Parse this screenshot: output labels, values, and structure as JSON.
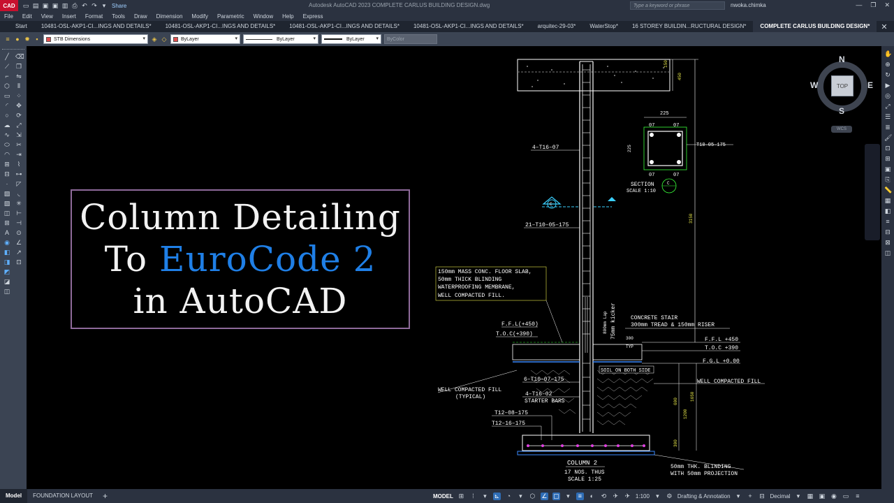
{
  "app": {
    "logo": "CAD",
    "title": "Autodesk AutoCAD 2023    COMPLETE CARLUS BUILDING DESIGN.dwg",
    "share": "Share",
    "search_placeholder": "Type a keyword or phrase",
    "user": "nwoka.chimka"
  },
  "menu": [
    "File",
    "Edit",
    "View",
    "Insert",
    "Format",
    "Tools",
    "Draw",
    "Dimension",
    "Modify",
    "Parametric",
    "Window",
    "Help",
    "Express"
  ],
  "tabs": [
    {
      "label": "Start"
    },
    {
      "label": "10481-OSL-AKP1-CI...INGS AND DETAILS*"
    },
    {
      "label": "10481-OSL-AKP1-CI...INGS AND DETAILS*"
    },
    {
      "label": "10481-OSL-AKP1-CI...INGS AND DETAILS*"
    },
    {
      "label": "10481-OSL-AKP1-CI...INGS AND DETAILS*"
    },
    {
      "label": "arquitec-29-03*"
    },
    {
      "label": "WaterStop*"
    },
    {
      "label": "16 STOREY BUILDIN...RUCTURAL DESIGN*"
    },
    {
      "label": "COMPLETE CARLUS BUILDING DESIGN*"
    }
  ],
  "properties": {
    "layer": "STB Dimensions",
    "color": "ByLayer",
    "linetype": "ByLayer",
    "lineweight": "ByLayer",
    "plotstyle": "ByColor"
  },
  "overlay": {
    "line1": "Column Detailing",
    "line2_prefix": "To ",
    "line2_accent": "EuroCode 2",
    "line3": "in AutoCAD",
    "accent_color": "#1f7fe6",
    "border_color": "#8e6a9a"
  },
  "viewcube": {
    "n": "N",
    "s": "S",
    "e": "E",
    "w": "W",
    "top": "TOP",
    "wcs": "WCS"
  },
  "drawing": {
    "labels": {
      "bars_upper": "4–T16–07",
      "links_upper": "21–T10–05–175",
      "section_label": "SECTION",
      "section_tag": "C",
      "section_scale": "SCALE 1:10",
      "sec_dim": "225",
      "sec_dim_v": "225",
      "sec_bar": "07",
      "sec_links": "T10–05–175",
      "dim_150": "150",
      "dim_450": "450",
      "dim_3150": "3150",
      "slab1": "150mm MASS CONC. FLOOR SLAB,",
      "slab2": "50mm THICK BLINDING",
      "slab3": "WATERPROOFING MEMBRANE,",
      "slab4": "WELL COMPACTED FILL.",
      "ffl_left": "F.F.L(+450)",
      "toc_left": "T.O.C(+390)",
      "lap": "800mm Lap",
      "kicker": "75mm kicker",
      "stair1": "CONCRETE STAIR",
      "stair2": "300mm TREAD & 150mm RISER",
      "ffl_right": "F.F.L  +450",
      "toc_right": "T.O.C  +390",
      "fgl": "F.G.L  +0.00",
      "typ": "TYP",
      "d300": "300",
      "soil": "SOIL ON BOTH SIDE",
      "fill_right": "WELL COMPACTED FILL",
      "fill_left1": "WELL COMPACTED FILL",
      "fill_left2": "(TYPICAL)",
      "links_lower": "6–T10–07–175",
      "starter1": "4–T16–02",
      "starter2": "STARTER BARS",
      "base1": "T12–08–175",
      "base2": "T12–16–175",
      "d600": "600",
      "d1200": "1200",
      "d1650": "1650",
      "d300b": "300",
      "blind1": "50mm THK. BLINDING",
      "blind2": "WITH 50mm PROJECTION",
      "col_title": "COLUMN  2",
      "col_nos": "17 NOS. THUS",
      "col_scale": "SCALE  1:25"
    }
  },
  "status": {
    "layout_tabs": [
      "Model",
      "FOUNDATION LAYOUT"
    ],
    "mode": "MODEL",
    "scale": "1:100",
    "workspace": "Drafting & Annotation",
    "units": "Decimal"
  }
}
